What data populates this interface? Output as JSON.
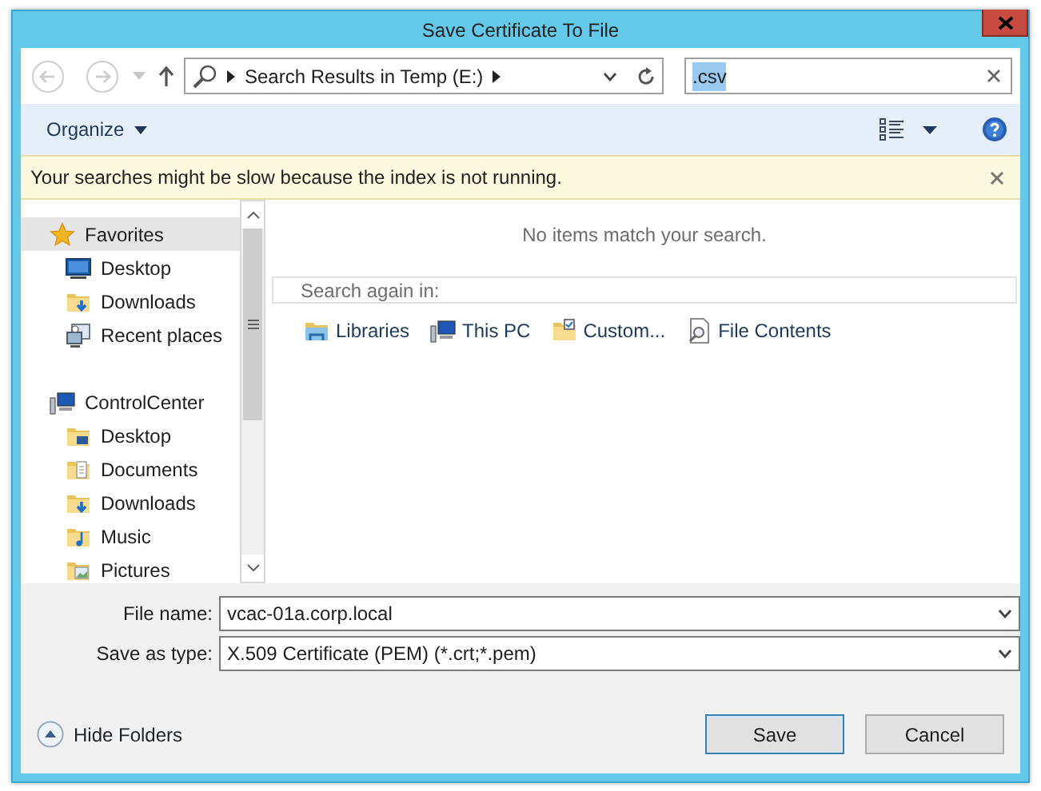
{
  "window": {
    "title": "Save Certificate To File"
  },
  "address_bar": {
    "path": "Search Results in Temp (E:)"
  },
  "search": {
    "value": ".csv",
    "highlighted": true
  },
  "command_bar": {
    "organize": "Organize"
  },
  "info_bar": {
    "message": "Your searches might be slow because the index is not running."
  },
  "navigation": [
    {
      "label": "Favorites",
      "kind": "favorites",
      "selected": true,
      "children": [
        {
          "label": "Desktop",
          "kind": "desktop",
          "selected": false
        },
        {
          "label": "Downloads",
          "kind": "downloads",
          "selected": false
        },
        {
          "label": "Recent places",
          "kind": "recent",
          "selected": false
        }
      ]
    },
    {
      "label": "ControlCenter",
      "kind": "computer",
      "selected": false,
      "children": [
        {
          "label": "Desktop",
          "kind": "desktop-folder",
          "selected": false
        },
        {
          "label": "Documents",
          "kind": "documents",
          "selected": false
        },
        {
          "label": "Downloads",
          "kind": "downloads",
          "selected": false
        },
        {
          "label": "Music",
          "kind": "music",
          "selected": false
        },
        {
          "label": "Pictures",
          "kind": "pictures",
          "selected": false
        }
      ]
    }
  ],
  "content": {
    "empty_message": "No items match your search.",
    "search_again_label": "Search again in:",
    "locations": [
      {
        "label": "Libraries",
        "kind": "libraries"
      },
      {
        "label": "This PC",
        "kind": "computer"
      },
      {
        "label": "Custom...",
        "kind": "custom"
      },
      {
        "label": "File Contents",
        "kind": "file-contents"
      }
    ]
  },
  "form": {
    "fields": [
      {
        "label": "File name:",
        "value": "vcac-01a.corp.local"
      },
      {
        "label": "Save as type:",
        "value": "X.509 Certificate (PEM) (*.crt;*.pem)"
      }
    ]
  },
  "hide_folders": "Hide Folders",
  "buttons": [
    {
      "label": "Save",
      "default": true
    },
    {
      "label": "Cancel",
      "default": false
    }
  ]
}
